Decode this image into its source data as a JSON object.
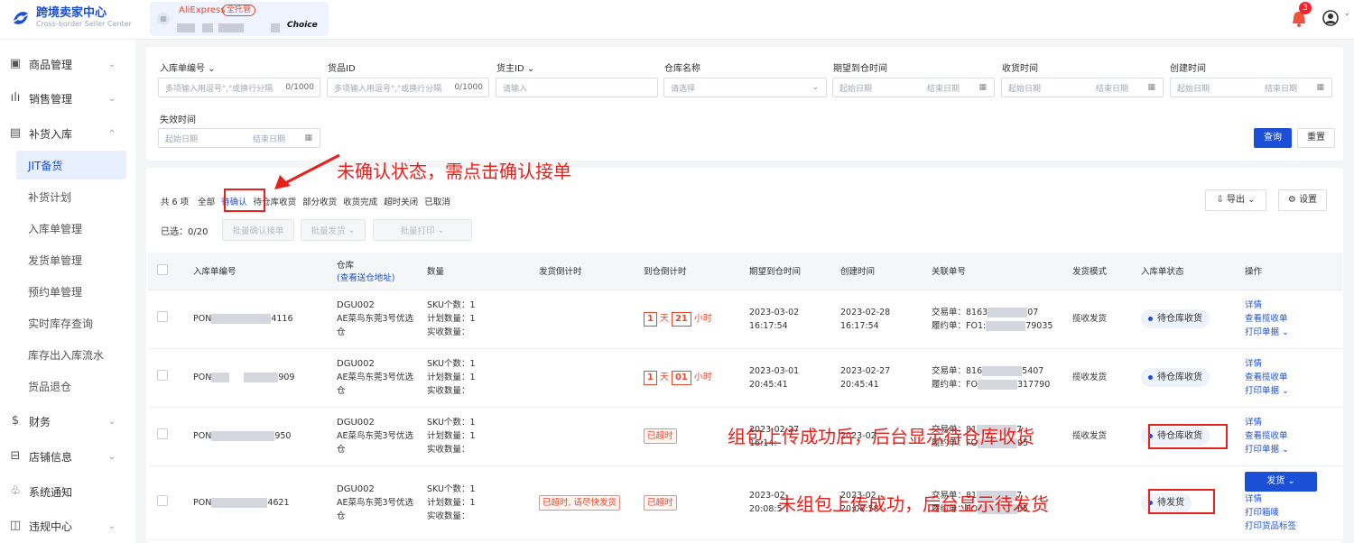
{
  "header": {
    "brand_title": "跨境卖家中心",
    "brand_subtitle": "Cross-border Seller Center",
    "store_name": "AliExpress",
    "store_tag": "全托管",
    "store_choice": "Choice",
    "notification_count": "3"
  },
  "sidebar": {
    "items": [
      {
        "label": "商品管理",
        "icon": "product-icon"
      },
      {
        "label": "销售管理",
        "icon": "sales-icon"
      },
      {
        "label": "补货入库",
        "icon": "restock-icon"
      },
      {
        "label": "财务",
        "icon": "finance-icon"
      },
      {
        "label": "店铺信息",
        "icon": "shop-icon"
      },
      {
        "label": "系统通知",
        "icon": "notify-icon"
      },
      {
        "label": "违规中心",
        "icon": "violation-icon"
      }
    ],
    "subitems": [
      "JIT备货",
      "补货计划",
      "入库单管理",
      "发货单管理",
      "预约单管理",
      "实时库存查询",
      "库存出入库流水",
      "货品退仓"
    ]
  },
  "filters": {
    "f1_label": "入库单编号",
    "f1_placeholder": "多项输入用逗号\",\"或换行分隔",
    "f1_count": "0/1000",
    "f2_label": "货品ID",
    "f2_placeholder": "多项输入用逗号\",\"或换行分隔",
    "f2_count": "0/1000",
    "f3_label": "货主ID",
    "f3_placeholder": "请输入",
    "f4_label": "仓库名称",
    "f4_placeholder": "请选择",
    "f5_label": "期望到仓时间",
    "f6_label": "收货时间",
    "f7_label": "创建时间",
    "f8_label": "失效时间",
    "start_date": "起始日期",
    "end_date": "结束日期",
    "query": "查询",
    "reset": "重置"
  },
  "list": {
    "total": "共 6 项",
    "tabs": [
      "全部",
      "待确认",
      "待仓库收货",
      "部分收货",
      "收货完成",
      "超时关闭",
      "已取消"
    ],
    "selected": "已选：0/20",
    "batch_confirm": "批量确认接单",
    "batch_ship": "批量发货",
    "batch_print": "批量打印",
    "export": "导出",
    "settings": "设置"
  },
  "table": {
    "headers": [
      "入库单编号",
      "仓库",
      "(查看送仓地址)",
      "数量",
      "发货倒计时",
      "到仓倒计时",
      "期望到仓时间",
      "创建时间",
      "关联单号",
      "发货模式",
      "入库单状态",
      "操作"
    ],
    "rows": [
      {
        "id_pre": "PON",
        "id_suf": "4116",
        "wh": "DGU002",
        "wh_name": "AE菜鸟东莞3号优选仓",
        "sku": "SKU个数：1",
        "plan": "计划数量：1",
        "recv": "实收数量：",
        "ship_cd": "",
        "arr_day": "1",
        "arr_day_unit": "天",
        "arr_hour": "21",
        "arr_hour_unit": "小时",
        "exp_date": "2023-03-02",
        "exp_time": "16:17:54",
        "cr_date": "2023-02-28",
        "cr_time": "16:17:54",
        "trade_lbl": "交易单：",
        "trade_pre": "8163",
        "trade_suf": "07",
        "fulfil_lbl": "履约单：",
        "fulfil_pre": "FO1:",
        "fulfil_suf": "79035",
        "mode": "揽收发货",
        "status": "待仓库收货",
        "ops": [
          "详情",
          "查看揽收单",
          "打印单据"
        ]
      },
      {
        "id_pre": "PON",
        "id_suf": "909",
        "wh": "DGU002",
        "wh_name": "AE菜鸟东莞3号优选仓",
        "sku": "SKU个数：1",
        "plan": "计划数量：1",
        "recv": "实收数量：",
        "ship_cd": "",
        "arr_day": "1",
        "arr_day_unit": "天",
        "arr_hour": "01",
        "arr_hour_unit": "小时",
        "exp_date": "2023-03-01",
        "exp_time": "20:45:41",
        "cr_date": "2023-02-27",
        "cr_time": "20:45:41",
        "trade_lbl": "交易单：",
        "trade_pre": "816",
        "trade_suf": "5407",
        "fulfil_lbl": "履约单：",
        "fulfil_pre": "FO",
        "fulfil_suf": "317790",
        "mode": "揽收发货",
        "status": "待仓库收货",
        "ops": [
          "详情",
          "查看揽收单",
          "打印单据"
        ]
      },
      {
        "id_pre": "PON",
        "id_suf": "950",
        "wh": "DGU002",
        "wh_name": "AE菜鸟东莞3号优选仓",
        "sku": "SKU个数：1",
        "plan": "计划数量：1",
        "recv": "实收数量：",
        "ship_cd": "",
        "arr_tag": "已超时",
        "exp_date": "2023-02-27",
        "exp_time": "16:14:",
        "cr_date": "2023-02",
        "cr_time": "",
        "trade_lbl": "交易单：",
        "trade_pre": "81",
        "trade_suf": "7",
        "fulfil_lbl": "履约单：",
        "fulfil_pre": "FO",
        "fulfil_suf": "95",
        "mode": "揽收发货",
        "status": "待仓库收货",
        "ops": [
          "详情",
          "查看揽收单",
          "打印单据"
        ]
      },
      {
        "id_pre": "PON",
        "id_suf": "4621",
        "wh": "DGU002",
        "wh_name": "AE菜鸟东莞3号优选仓",
        "sku": "SKU个数：1",
        "plan": "计划数量：1",
        "recv": "实收数量：",
        "ship_tag": "已超时, 请尽快发货",
        "arr_tag": "已超时",
        "exp_date": "2023-02-",
        "exp_time": "20:08:5",
        "cr_date": "2023-02",
        "cr_time": "20:08:58",
        "trade_lbl": "交易单：",
        "trade_pre": "81",
        "trade_suf": "7",
        "fulfil_lbl": "履约单：",
        "fulfil_pre": "FO",
        "fulfil_suf": "65",
        "mode": "",
        "status": "待发货",
        "ship_btn": "发货",
        "ops": [
          "详情",
          "打印箱唛",
          "打印货品标签"
        ]
      }
    ]
  },
  "annotations": {
    "a1": "未确认状态，需点击确认接单",
    "a2": "组包上传成功后，后台显示待仓库收货",
    "a3": "未组包上传成功，后台显示待发货"
  },
  "colors": {
    "primary": "#1a4fd6",
    "annotation": "#e8201b",
    "warning": "#e8492d"
  }
}
